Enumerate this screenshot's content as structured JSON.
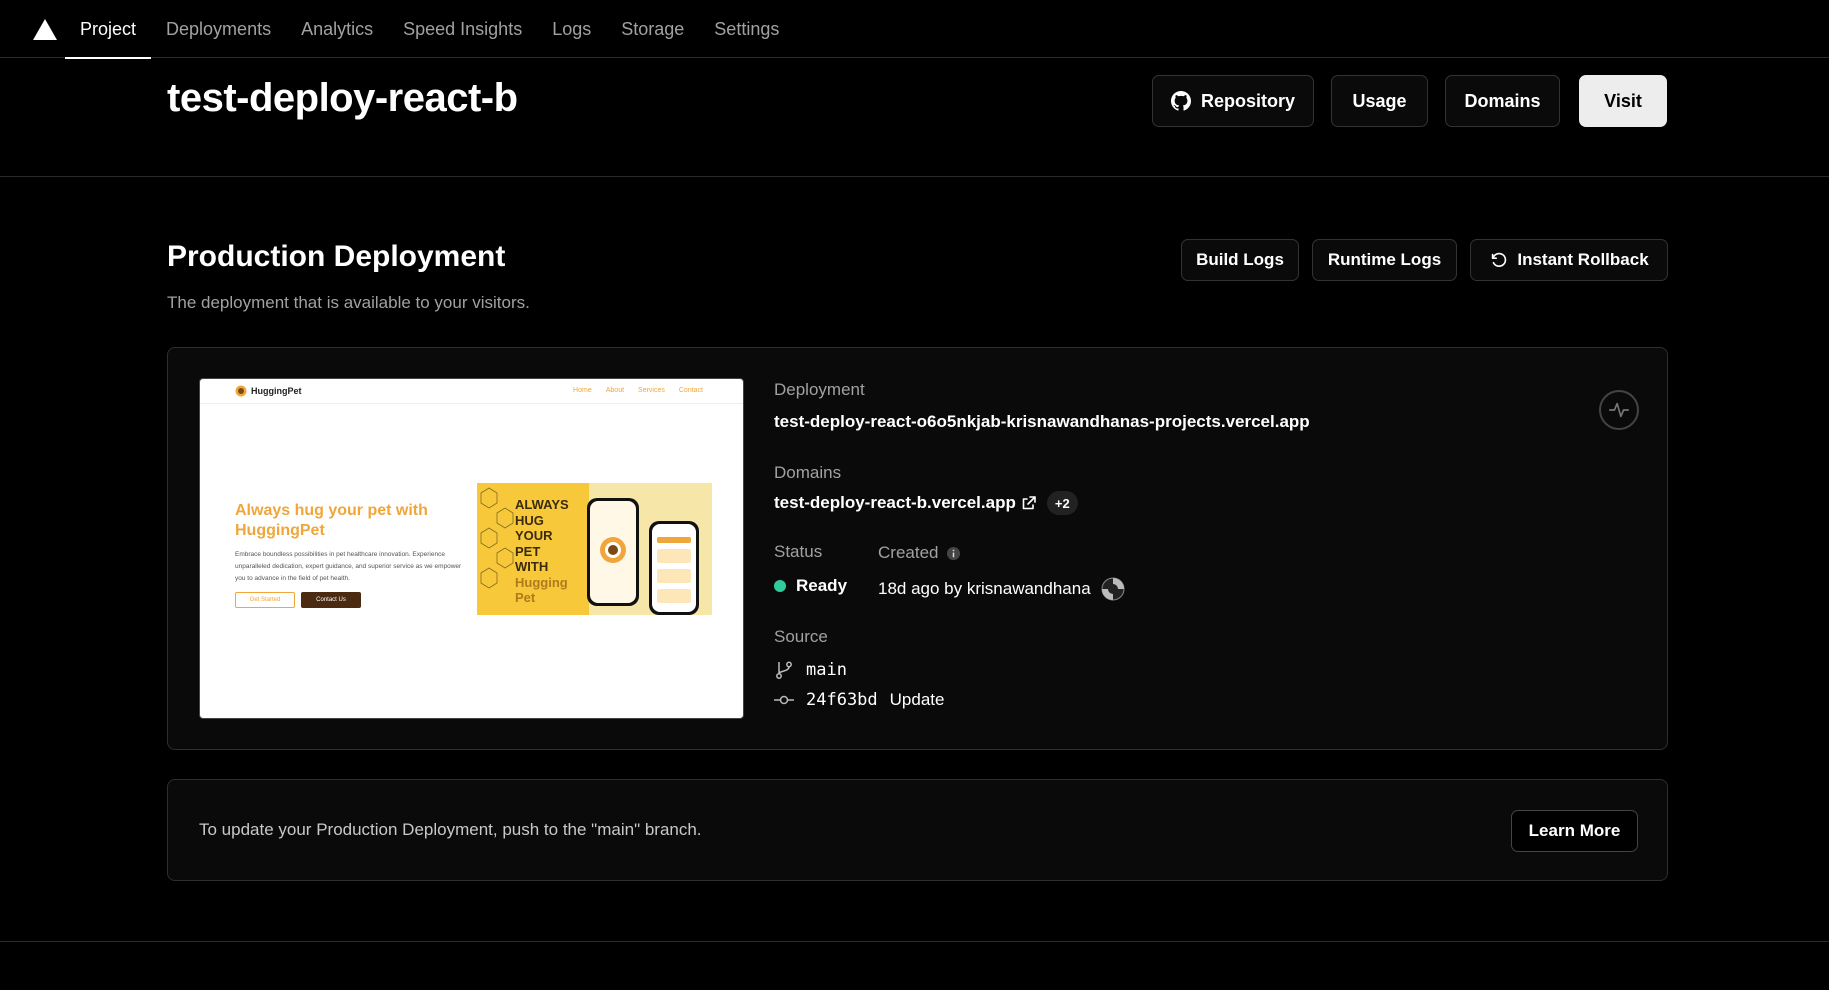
{
  "nav": {
    "tabs": [
      {
        "label": "Project"
      },
      {
        "label": "Deployments"
      },
      {
        "label": "Analytics"
      },
      {
        "label": "Speed Insights"
      },
      {
        "label": "Logs"
      },
      {
        "label": "Storage"
      },
      {
        "label": "Settings"
      }
    ],
    "active_tab": "Project"
  },
  "header": {
    "title": "test-deploy-react-b",
    "buttons": {
      "repository": "Repository",
      "usage": "Usage",
      "domains": "Domains",
      "visit": "Visit"
    }
  },
  "section": {
    "title": "Production Deployment",
    "subtitle": "The deployment that is available to your visitors.",
    "buttons": {
      "build_logs": "Build Logs",
      "runtime_logs": "Runtime Logs",
      "instant_rollback": "Instant Rollback"
    }
  },
  "deployment": {
    "deployment_label": "Deployment",
    "deployment_url": "test-deploy-react-o6o5nkjab-krisnawandhanas-projects.vercel.app",
    "domains_label": "Domains",
    "domain": "test-deploy-react-b.vercel.app",
    "domain_extra": "+2",
    "status_label": "Status",
    "status": "Ready",
    "status_color": "#2ecc9b",
    "created_label": "Created",
    "created": "18d ago by krisnawandhana",
    "source_label": "Source",
    "branch": "main",
    "commit_hash": "24f63bd",
    "commit_message": "Update"
  },
  "preview": {
    "brand": "HuggingPet",
    "links": [
      "Home",
      "About",
      "Services",
      "Contact"
    ],
    "headline": "Always hug your pet with HuggingPet",
    "body": "Embrace boundless possibilities in pet healthcare innovation. Experience unparalleled dedication, expert guidance, and superior service as we empower you to advance in the field of pet health.",
    "btn_primary": "Get Started",
    "btn_secondary": "Contact Us",
    "hero_lines": [
      "ALWAYS",
      "HUG",
      "YOUR",
      "PET",
      "WITH"
    ],
    "hero_accent": [
      "Hugging",
      "Pet"
    ],
    "accent_color": "#f0a63a"
  },
  "note": {
    "text": "To update your Production Deployment, push to the \"main\" branch.",
    "button": "Learn More"
  }
}
